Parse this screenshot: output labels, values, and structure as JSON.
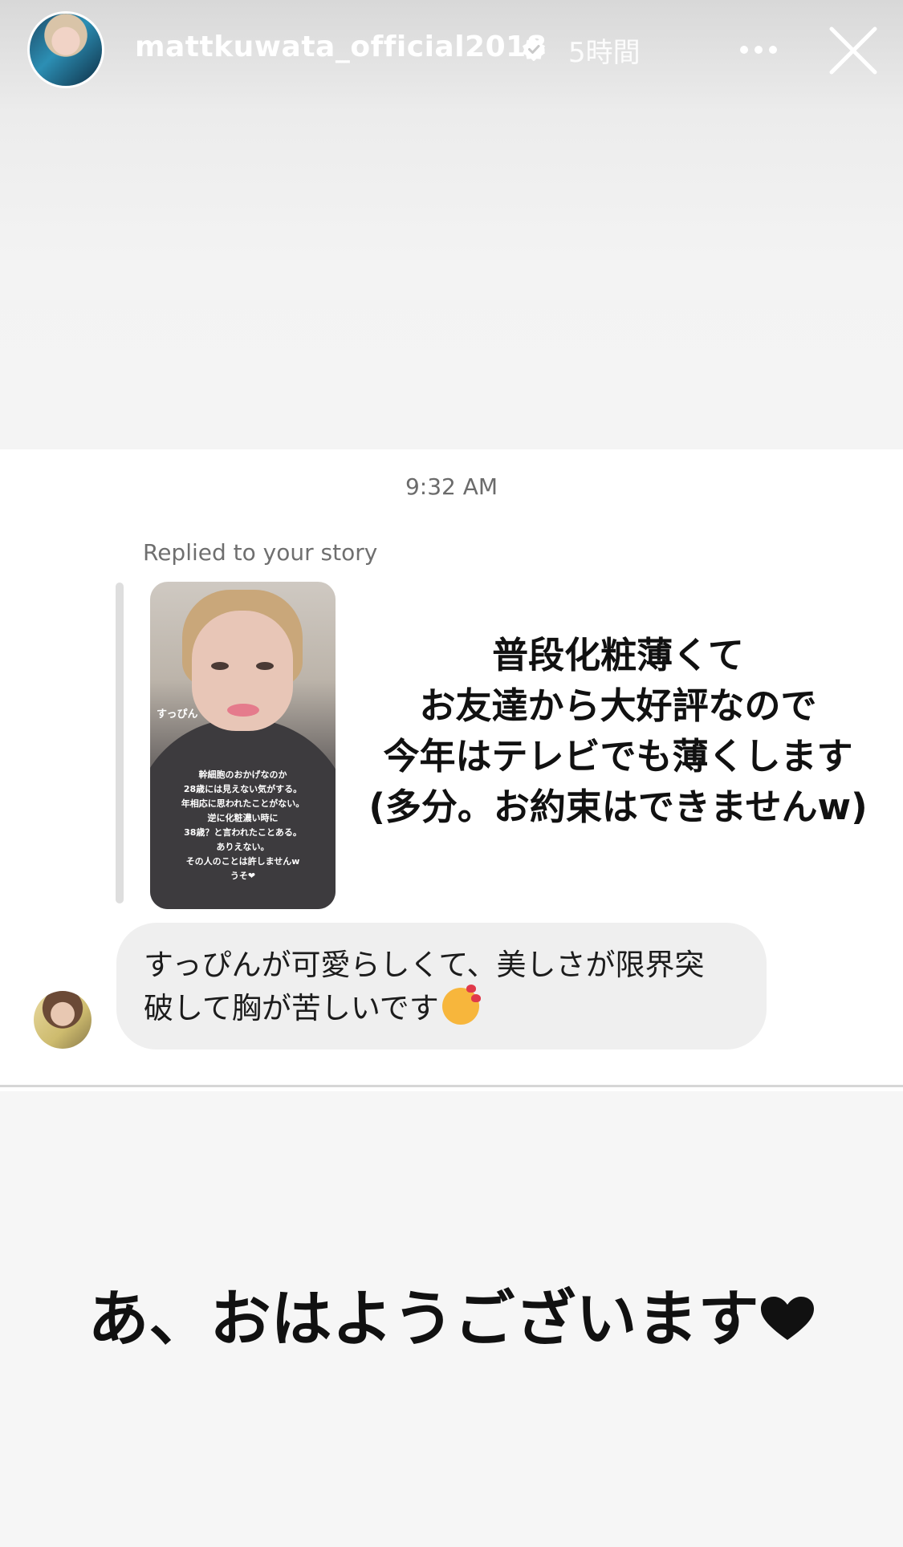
{
  "story_header": {
    "username": "mattkuwata_official2018",
    "time_ago": "5時間",
    "icons": [
      "verified-badge-icon",
      "more-icon",
      "close-icon"
    ]
  },
  "dm": {
    "timestamp": "9:32 AM",
    "replied_label": "Replied to your story",
    "story_preview": {
      "label": "すっぴん",
      "lines": [
        "幹細胞のおかげなのか",
        "28歳には見えない気がする。",
        "年相応に思われたことがない。",
        "逆に化粧濃い時に",
        "38歳？と言われたことある。",
        "ありえない。",
        "その人のことは許しませんw",
        "うそ❤"
      ]
    },
    "message_lines": [
      "すっぴんが可愛らしくて、美しさが限界突",
      "破して胸が苦しいです"
    ],
    "message_emoji": "smiling-face-with-hearts-icon"
  },
  "overlay_text_lines": [
    "普段化粧薄くて",
    "お友達から大好評なので",
    "今年はテレビでも薄くします",
    "(多分。お約束はできませんw)"
  ],
  "caption": "あ、おはようございます",
  "colors": {
    "text_dark": "#111111",
    "bubble": "#efefef",
    "muted": "#6b6b6b"
  }
}
